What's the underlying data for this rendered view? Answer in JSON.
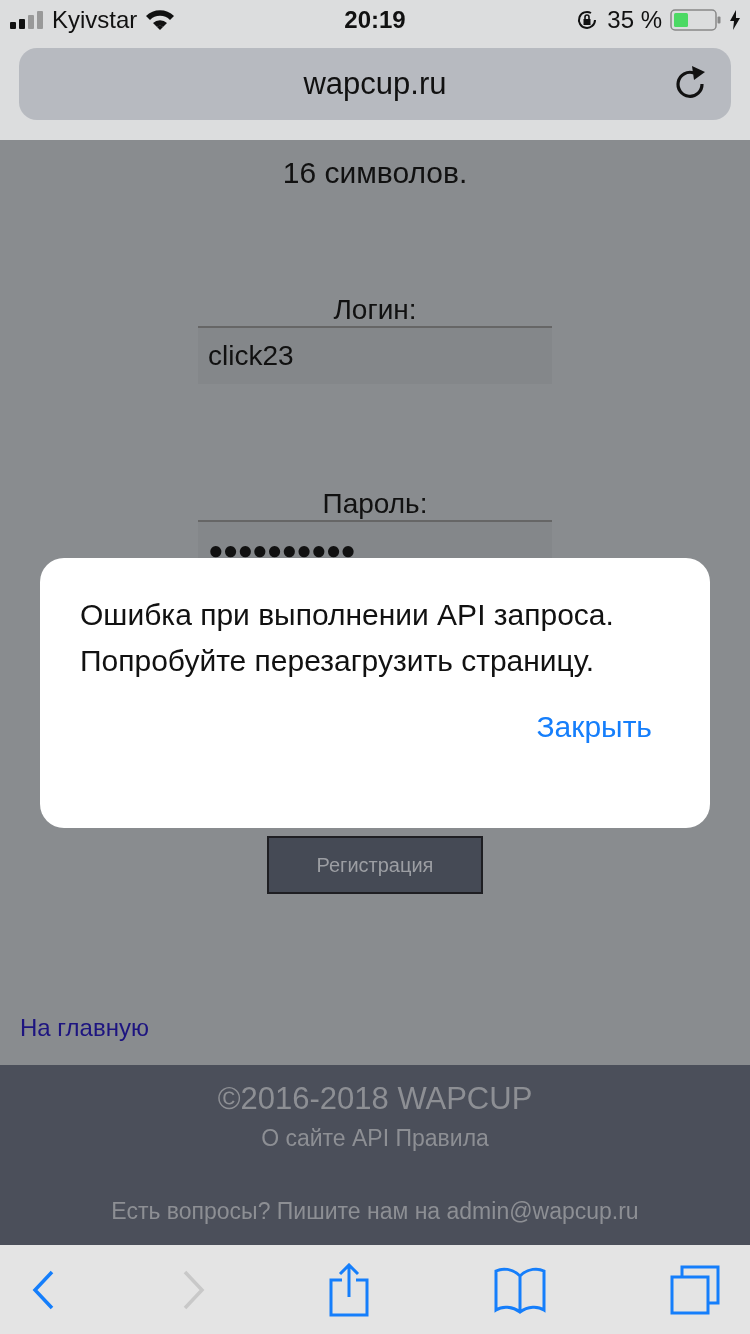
{
  "status_bar": {
    "carrier": "Kyivstar",
    "time": "20:19",
    "battery": "35 %"
  },
  "address_bar": {
    "url": "wapcup.ru"
  },
  "page": {
    "note_tail": "16 символов.",
    "fields": [
      {
        "label": "Логин:",
        "value": "click23",
        "kind": "text"
      },
      {
        "label": "Пароль:",
        "value": "●●●●●●●●●●",
        "kind": "password"
      }
    ],
    "register_button": "Регистрация",
    "home_link": "На главную"
  },
  "footer": {
    "copyright": "©2016-2018 WAPCUP",
    "links": "О сайте API Правила",
    "contact": "Есть вопросы? Пишите нам на admin@wapcup.ru"
  },
  "alert": {
    "message": "Ошибка при выполнении API запроса. Попробуйте перезагрузить страницу.",
    "button": "Закрыть"
  },
  "toolbar": [
    {
      "kind": "back",
      "disabled": false
    },
    {
      "kind": "forward",
      "disabled": true
    },
    {
      "kind": "share",
      "disabled": false
    },
    {
      "kind": "bookmarks",
      "disabled": false
    },
    {
      "kind": "tabs",
      "disabled": false
    }
  ]
}
